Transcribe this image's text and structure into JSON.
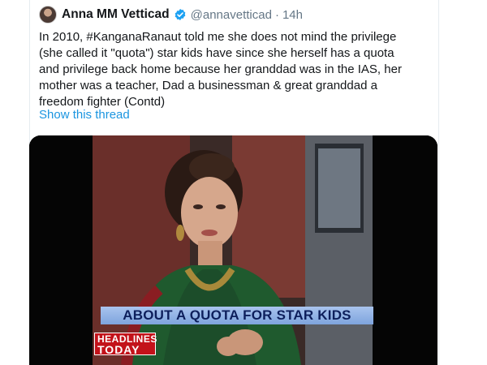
{
  "tweet": {
    "author_name": "Anna MM Vetticad",
    "handle": "@annavetticad",
    "separator": "·",
    "time": "14h",
    "text_lines": [
      "In 2010, #KanganaRanaut told me she does not mind the privilege",
      "(she called it \"quota\") star kids have since she herself has a quota",
      "and privilege back home because her granddad was in the IAS, her",
      "mother was a teacher, Dad a businessman & great granddad a",
      "freedom fighter (Contd)"
    ],
    "show_thread": "Show this thread"
  },
  "media": {
    "banner_text": "ABOUT A QUOTA FOR STAR KIDS",
    "logo_line1": "HEADLINES",
    "logo_line2": "TODAY"
  },
  "colors": {
    "link": "#1b95e0",
    "verified": "#1da1f2",
    "text": "#14171a",
    "muted": "#657786",
    "logo_red": "#c3121a"
  },
  "icons": {
    "verified": "verified-badge-icon",
    "avatar": "avatar"
  }
}
